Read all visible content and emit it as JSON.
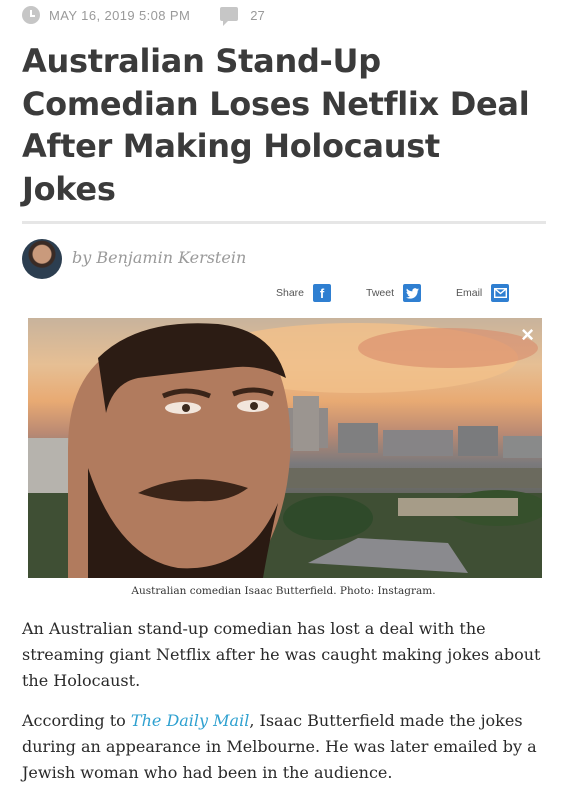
{
  "meta": {
    "date": "MAY 16, 2019 5:08 PM",
    "comment_count": "27",
    "icons": [
      "clock-icon",
      "comment-icon"
    ]
  },
  "article": {
    "headline": "Australian Stand-Up Comedian Loses Netflix Deal After Making Holocaust Jokes",
    "byline": "by Benjamin Kerstein",
    "image_caption": "Australian comedian Isaac Butterfield. Photo: Instagram.",
    "paragraph1": "An Australian stand-up comedian has lost a deal with the streaming giant Netflix after he was caught making jokes about the Holocaust.",
    "paragraph2": {
      "before": "According to ",
      "link": "The Daily Mail",
      "after": ", Isaac Butterfield made the jokes during an appearance in Melbourne. He was later emailed by a Jewish woman who had been in the audience."
    }
  },
  "share": {
    "share_label": "Share",
    "tweet_label": "Tweet",
    "email_label": "Email",
    "facebook_glyph": "f",
    "colors": {
      "facebook": "#2f7fd1",
      "twitter": "#2f7fd1",
      "email": "#2f7fd1"
    }
  },
  "image": {
    "close_glyph": "×"
  },
  "colors": {
    "link": "#2fa1d0",
    "headline": "#3b3b3b"
  }
}
